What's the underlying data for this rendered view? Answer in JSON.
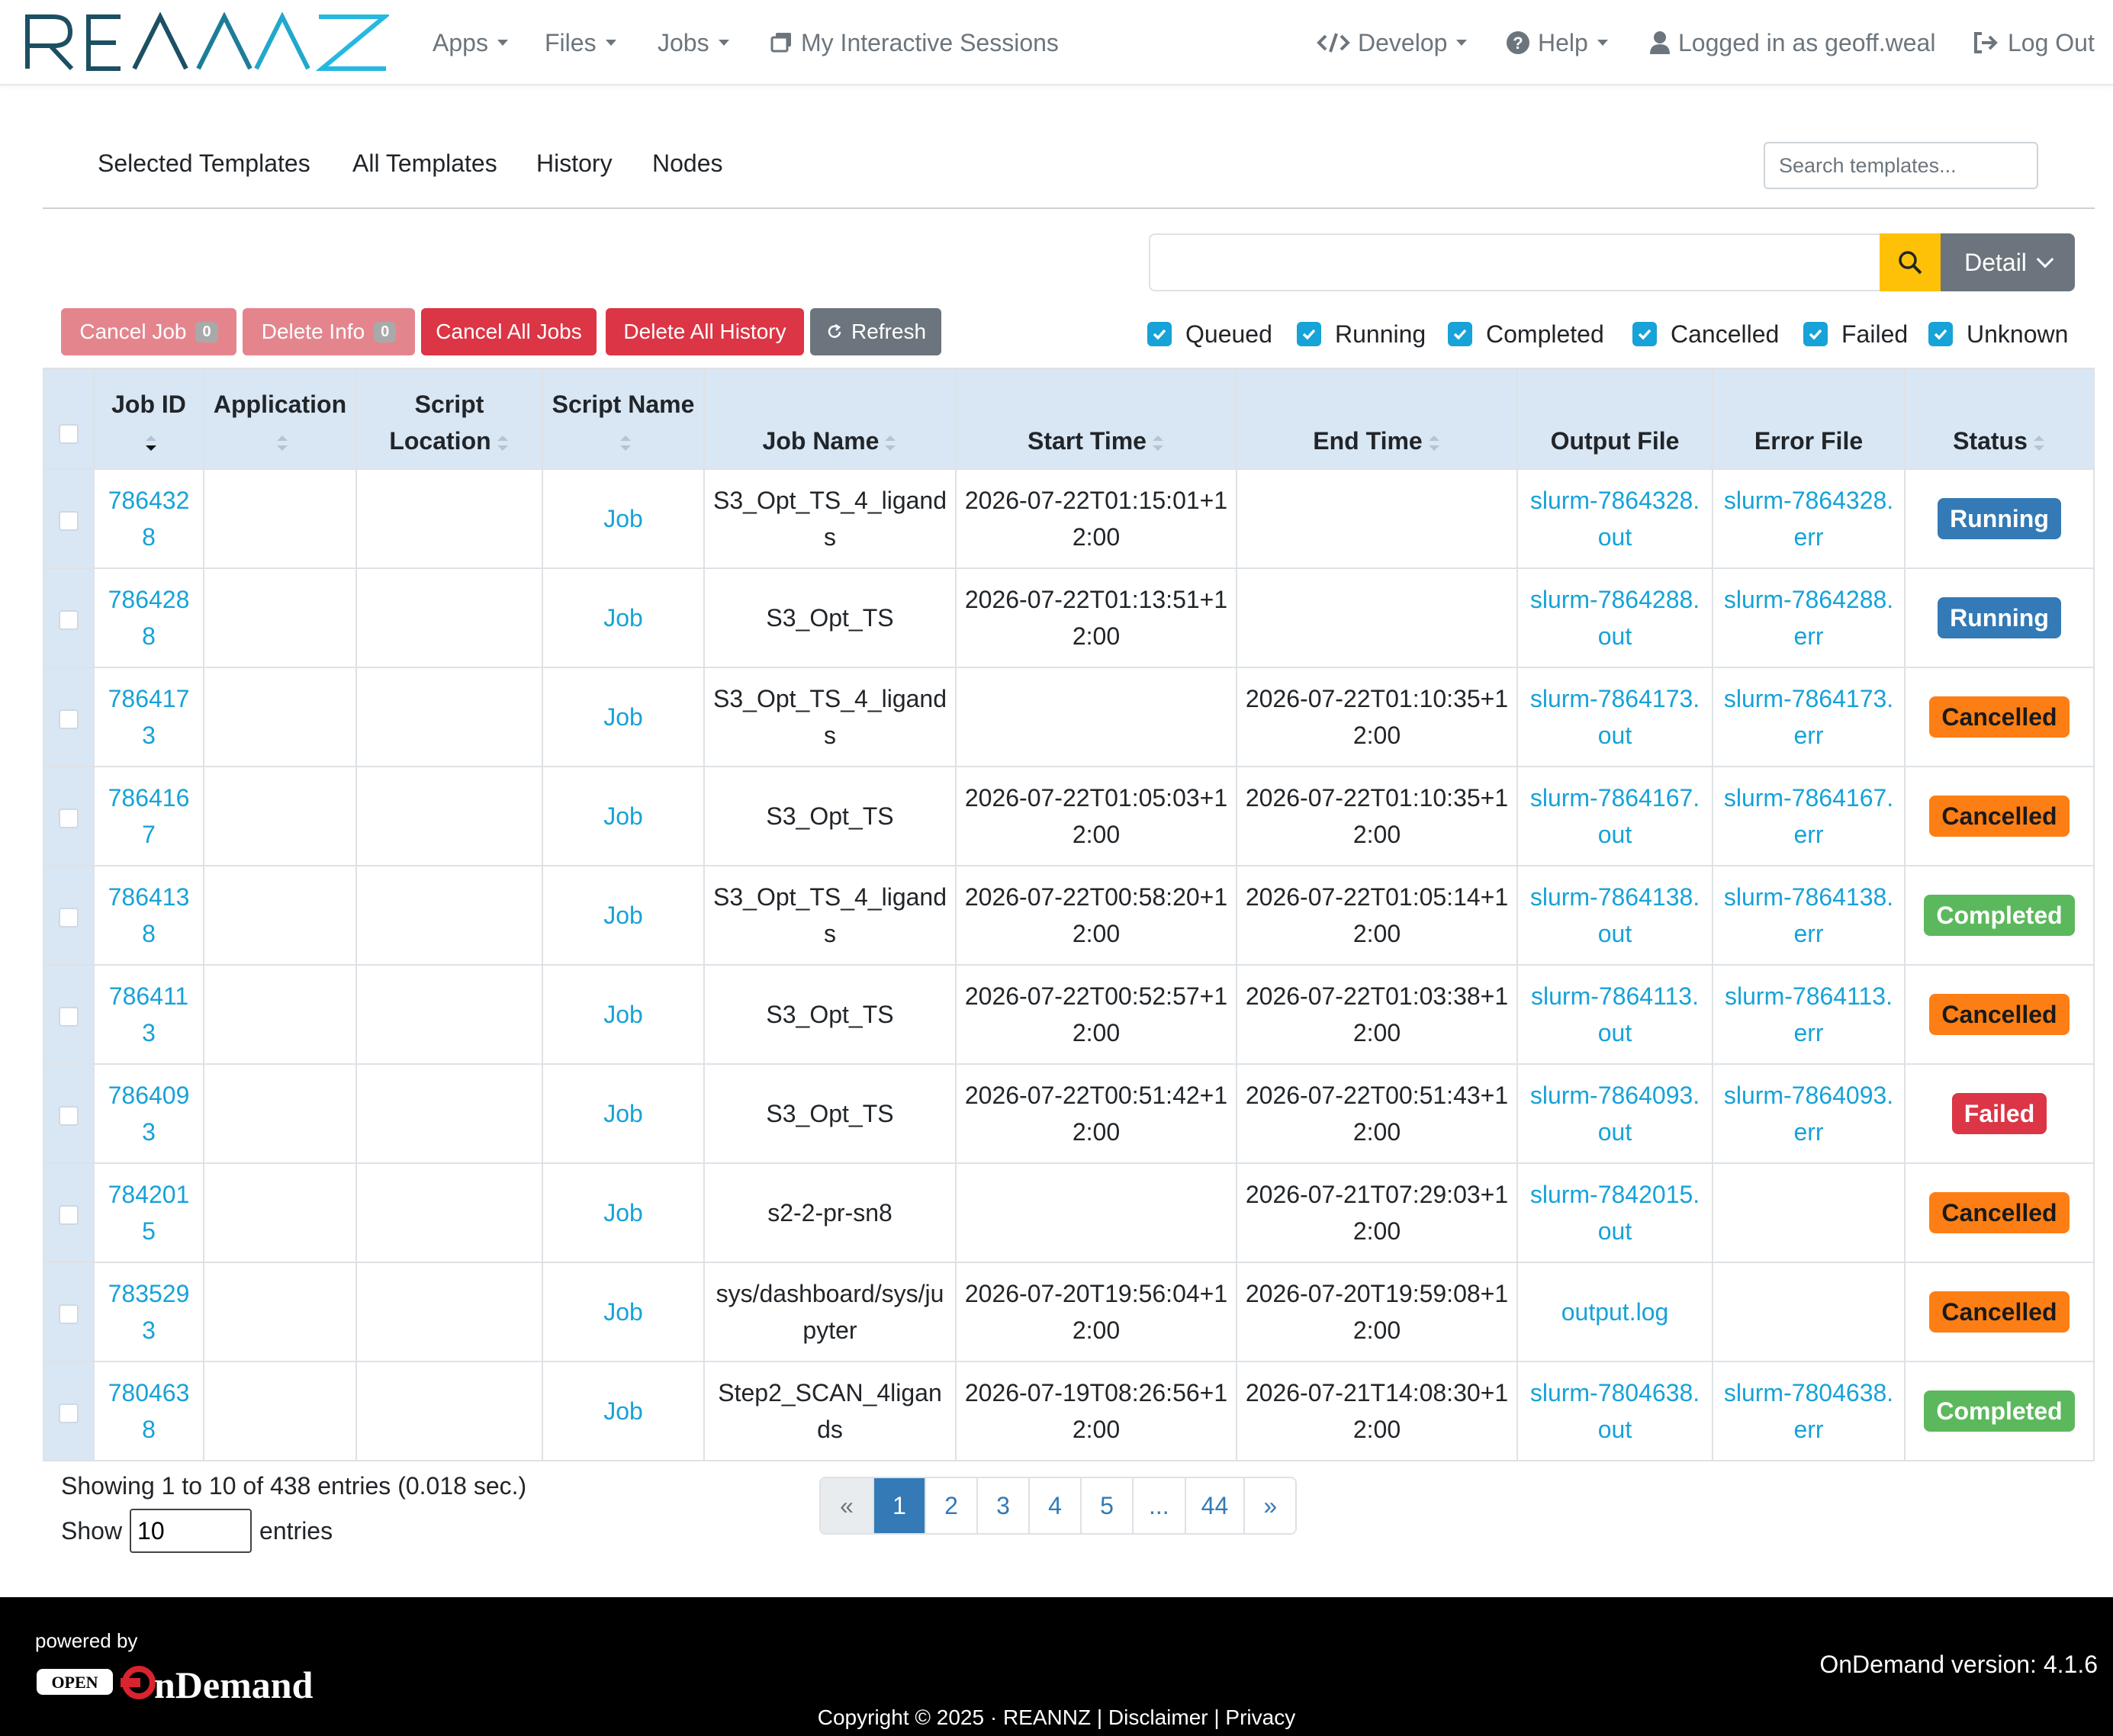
{
  "brand": {
    "logo_text": "REANNZ"
  },
  "nav": {
    "apps": "Apps",
    "files": "Files",
    "jobs": "Jobs",
    "sessions": "My Interactive Sessions",
    "develop": "Develop",
    "help": "Help",
    "user": "Logged in as geoff.weal",
    "logout": "Log Out"
  },
  "tabs": [
    "Selected Templates",
    "All Templates",
    "History",
    "Nodes"
  ],
  "template_search": {
    "placeholder": "Search templates..."
  },
  "filter": {
    "value": "",
    "detail_label": "Detail"
  },
  "actions": {
    "cancel_job": "Cancel Job",
    "cancel_job_count": "0",
    "delete_info": "Delete Info",
    "delete_info_count": "0",
    "cancel_all": "Cancel All Jobs",
    "delete_all": "Delete All History",
    "refresh": "Refresh"
  },
  "status_filters": [
    "Queued",
    "Running",
    "Completed",
    "Cancelled",
    "Failed",
    "Unknown"
  ],
  "table": {
    "headers": {
      "job_id": "Job ID",
      "application": "Application",
      "script_location": "Script Location",
      "script_name": "Script Name",
      "job_name": "Job Name",
      "start_time": "Start Time",
      "end_time": "End Time",
      "output_file": "Output File",
      "error_file": "Error File",
      "status": "Status"
    },
    "rows": [
      {
        "job_id": "7864328",
        "application": "",
        "script_location": "",
        "script_name": "Job",
        "job_name": "S3_Opt_TS_4_ligands",
        "start": "2026-07-22T01:15:01+12:00",
        "end": "",
        "out": "slurm-7864328.out",
        "err": "slurm-7864328.err",
        "status": "Running"
      },
      {
        "job_id": "7864288",
        "application": "",
        "script_location": "",
        "script_name": "Job",
        "job_name": "S3_Opt_TS",
        "start": "2026-07-22T01:13:51+12:00",
        "end": "",
        "out": "slurm-7864288.out",
        "err": "slurm-7864288.err",
        "status": "Running"
      },
      {
        "job_id": "7864173",
        "application": "",
        "script_location": "",
        "script_name": "Job",
        "job_name": "S3_Opt_TS_4_ligands",
        "start": "",
        "end": "2026-07-22T01:10:35+12:00",
        "out": "slurm-7864173.out",
        "err": "slurm-7864173.err",
        "status": "Cancelled"
      },
      {
        "job_id": "7864167",
        "application": "",
        "script_location": "",
        "script_name": "Job",
        "job_name": "S3_Opt_TS",
        "start": "2026-07-22T01:05:03+12:00",
        "end": "2026-07-22T01:10:35+12:00",
        "out": "slurm-7864167.out",
        "err": "slurm-7864167.err",
        "status": "Cancelled"
      },
      {
        "job_id": "7864138",
        "application": "",
        "script_location": "",
        "script_name": "Job",
        "job_name": "S3_Opt_TS_4_ligands",
        "start": "2026-07-22T00:58:20+12:00",
        "end": "2026-07-22T01:05:14+12:00",
        "out": "slurm-7864138.out",
        "err": "slurm-7864138.err",
        "status": "Completed"
      },
      {
        "job_id": "7864113",
        "application": "",
        "script_location": "",
        "script_name": "Job",
        "job_name": "S3_Opt_TS",
        "start": "2026-07-22T00:52:57+12:00",
        "end": "2026-07-22T01:03:38+12:00",
        "out": "slurm-7864113.out",
        "err": "slurm-7864113.err",
        "status": "Cancelled"
      },
      {
        "job_id": "7864093",
        "application": "",
        "script_location": "",
        "script_name": "Job",
        "job_name": "S3_Opt_TS",
        "start": "2026-07-22T00:51:42+12:00",
        "end": "2026-07-22T00:51:43+12:00",
        "out": "slurm-7864093.out",
        "err": "slurm-7864093.err",
        "status": "Failed"
      },
      {
        "job_id": "7842015",
        "application": "",
        "script_location": "",
        "script_name": "Job",
        "job_name": "s2-2-pr-sn8",
        "start": "",
        "end": "2026-07-21T07:29:03+12:00",
        "out": "slurm-7842015.out",
        "err": "",
        "status": "Cancelled"
      },
      {
        "job_id": "7835293",
        "application": "",
        "script_location": "",
        "script_name": "Job",
        "job_name": "sys/dashboard/sys/jupyter",
        "start": "2026-07-20T19:56:04+12:00",
        "end": "2026-07-20T19:59:08+12:00",
        "out": "output.log",
        "err": "",
        "status": "Cancelled"
      },
      {
        "job_id": "7804638",
        "application": "",
        "script_location": "",
        "script_name": "Job",
        "job_name": "Step2_SCAN_4ligands",
        "start": "2026-07-19T08:26:56+12:00",
        "end": "2026-07-21T14:08:30+12:00",
        "out": "slurm-7804638.out",
        "err": "slurm-7804638.err",
        "status": "Completed"
      }
    ]
  },
  "summary": {
    "info": "Showing 1 to 10 of 438 entries (0.018 sec.)",
    "show_label": "Show",
    "show_value": "10",
    "entries_label": "entries"
  },
  "pagination": [
    "«",
    "1",
    "2",
    "3",
    "4",
    "5",
    "...",
    "44",
    "»"
  ],
  "pagination_active": "1",
  "footer": {
    "powered_by": "powered by",
    "logo_open": "OPEN",
    "logo_ondemand": "nDemand",
    "version": "OnDemand version: 4.1.6",
    "copyright": "Copyright © 2025 · REANNZ | Disclaimer | Privacy"
  },
  "colors": {
    "link": "#17a2d8",
    "running": "#337ab7",
    "cancelled": "#fd7e14",
    "completed": "#5cb85c",
    "failed": "#dc3545",
    "header_bg": "#d9e6f3"
  }
}
